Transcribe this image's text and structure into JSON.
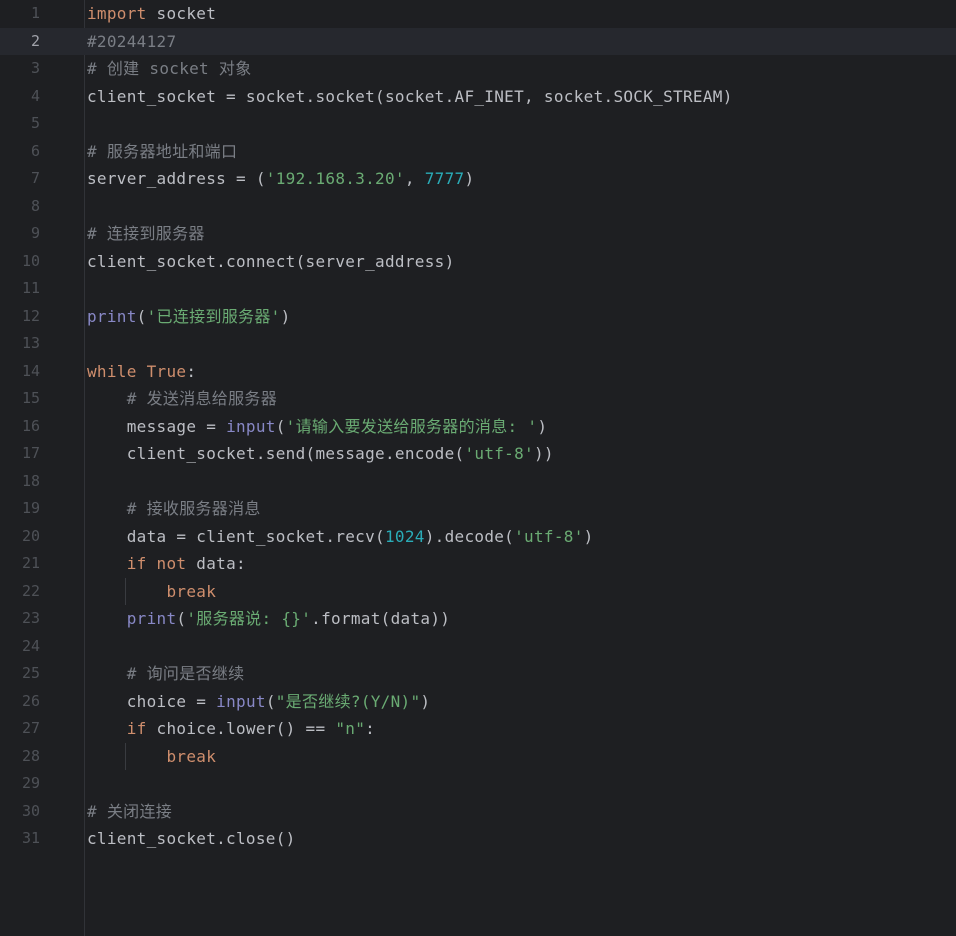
{
  "editor": {
    "current_line": 2,
    "colors": {
      "background": "#1e1f22",
      "current_line": "#26282e",
      "keyword": "#cf8e6d",
      "string": "#6aab73",
      "number": "#2aacb8",
      "comment": "#7a7e85",
      "builtin": "#8888c6",
      "identifier": "#bcbec4"
    },
    "lines": [
      {
        "n": "1",
        "guide": false,
        "tokens": [
          {
            "t": "import",
            "k": "kw"
          },
          {
            "t": " socket",
            "k": "id"
          }
        ]
      },
      {
        "n": "2",
        "guide": false,
        "tokens": [
          {
            "t": "#20244127",
            "k": "cm"
          }
        ]
      },
      {
        "n": "3",
        "guide": false,
        "tokens": [
          {
            "t": "# 创建 socket 对象",
            "k": "cm"
          }
        ]
      },
      {
        "n": "4",
        "guide": false,
        "tokens": [
          {
            "t": "client_socket = socket.socket(socket.AF_INET, socket.SOCK_STREAM)",
            "k": "id"
          }
        ]
      },
      {
        "n": "5",
        "guide": false,
        "tokens": []
      },
      {
        "n": "6",
        "guide": false,
        "tokens": [
          {
            "t": "# 服务器地址和端口",
            "k": "cm"
          }
        ]
      },
      {
        "n": "7",
        "guide": false,
        "tokens": [
          {
            "t": "server_address = (",
            "k": "id"
          },
          {
            "t": "'192.168.3.20'",
            "k": "str"
          },
          {
            "t": ", ",
            "k": "id"
          },
          {
            "t": "7777",
            "k": "num"
          },
          {
            "t": ")",
            "k": "id"
          }
        ]
      },
      {
        "n": "8",
        "guide": false,
        "tokens": []
      },
      {
        "n": "9",
        "guide": false,
        "tokens": [
          {
            "t": "# 连接到服务器",
            "k": "cm"
          }
        ]
      },
      {
        "n": "10",
        "guide": false,
        "tokens": [
          {
            "t": "client_socket.connect(server_address)",
            "k": "id"
          }
        ]
      },
      {
        "n": "11",
        "guide": false,
        "tokens": []
      },
      {
        "n": "12",
        "guide": false,
        "tokens": [
          {
            "t": "print",
            "k": "bi"
          },
          {
            "t": "(",
            "k": "id"
          },
          {
            "t": "'已连接到服务器'",
            "k": "str"
          },
          {
            "t": ")",
            "k": "id"
          }
        ]
      },
      {
        "n": "13",
        "guide": false,
        "tokens": []
      },
      {
        "n": "14",
        "guide": false,
        "tokens": [
          {
            "t": "while",
            "k": "kw"
          },
          {
            "t": " ",
            "k": "id"
          },
          {
            "t": "True",
            "k": "kw"
          },
          {
            "t": ":",
            "k": "id"
          }
        ]
      },
      {
        "n": "15",
        "guide": false,
        "tokens": [
          {
            "t": "    ",
            "k": "id"
          },
          {
            "t": "# 发送消息给服务器",
            "k": "cm"
          }
        ]
      },
      {
        "n": "16",
        "guide": false,
        "tokens": [
          {
            "t": "    message = ",
            "k": "id"
          },
          {
            "t": "input",
            "k": "bi"
          },
          {
            "t": "(",
            "k": "id"
          },
          {
            "t": "'请输入要发送给服务器的消息: '",
            "k": "str"
          },
          {
            "t": ")",
            "k": "id"
          }
        ]
      },
      {
        "n": "17",
        "guide": false,
        "tokens": [
          {
            "t": "    client_socket.send(message.encode(",
            "k": "id"
          },
          {
            "t": "'utf-8'",
            "k": "str"
          },
          {
            "t": "))",
            "k": "id"
          }
        ]
      },
      {
        "n": "18",
        "guide": false,
        "tokens": []
      },
      {
        "n": "19",
        "guide": false,
        "tokens": [
          {
            "t": "    ",
            "k": "id"
          },
          {
            "t": "# 接收服务器消息",
            "k": "cm"
          }
        ]
      },
      {
        "n": "20",
        "guide": false,
        "tokens": [
          {
            "t": "    data = client_socket.recv(",
            "k": "id"
          },
          {
            "t": "1024",
            "k": "num"
          },
          {
            "t": ").decode(",
            "k": "id"
          },
          {
            "t": "'utf-8'",
            "k": "str"
          },
          {
            "t": ")",
            "k": "id"
          }
        ]
      },
      {
        "n": "21",
        "guide": false,
        "tokens": [
          {
            "t": "    ",
            "k": "id"
          },
          {
            "t": "if",
            "k": "kw"
          },
          {
            "t": " ",
            "k": "id"
          },
          {
            "t": "not",
            "k": "kw"
          },
          {
            "t": " data:",
            "k": "id"
          }
        ]
      },
      {
        "n": "22",
        "guide": true,
        "tokens": [
          {
            "t": "        ",
            "k": "id"
          },
          {
            "t": "break",
            "k": "kw"
          }
        ]
      },
      {
        "n": "23",
        "guide": false,
        "tokens": [
          {
            "t": "    ",
            "k": "id"
          },
          {
            "t": "print",
            "k": "bi"
          },
          {
            "t": "(",
            "k": "id"
          },
          {
            "t": "'服务器说: {}'",
            "k": "str"
          },
          {
            "t": ".format(data))",
            "k": "id"
          }
        ]
      },
      {
        "n": "24",
        "guide": false,
        "tokens": []
      },
      {
        "n": "25",
        "guide": false,
        "tokens": [
          {
            "t": "    ",
            "k": "id"
          },
          {
            "t": "# 询问是否继续",
            "k": "cm"
          }
        ]
      },
      {
        "n": "26",
        "guide": false,
        "tokens": [
          {
            "t": "    choice = ",
            "k": "id"
          },
          {
            "t": "input",
            "k": "bi"
          },
          {
            "t": "(",
            "k": "id"
          },
          {
            "t": "\"是否继续?(Y/N)\"",
            "k": "str"
          },
          {
            "t": ")",
            "k": "id"
          }
        ]
      },
      {
        "n": "27",
        "guide": false,
        "tokens": [
          {
            "t": "    ",
            "k": "id"
          },
          {
            "t": "if",
            "k": "kw"
          },
          {
            "t": " choice.lower() == ",
            "k": "id"
          },
          {
            "t": "\"n\"",
            "k": "str"
          },
          {
            "t": ":",
            "k": "id"
          }
        ]
      },
      {
        "n": "28",
        "guide": true,
        "tokens": [
          {
            "t": "        ",
            "k": "id"
          },
          {
            "t": "break",
            "k": "kw"
          }
        ]
      },
      {
        "n": "29",
        "guide": false,
        "tokens": []
      },
      {
        "n": "30",
        "guide": false,
        "tokens": [
          {
            "t": "# 关闭连接",
            "k": "cm"
          }
        ]
      },
      {
        "n": "31",
        "guide": false,
        "tokens": [
          {
            "t": "client_socket.close()",
            "k": "id"
          }
        ]
      }
    ]
  }
}
